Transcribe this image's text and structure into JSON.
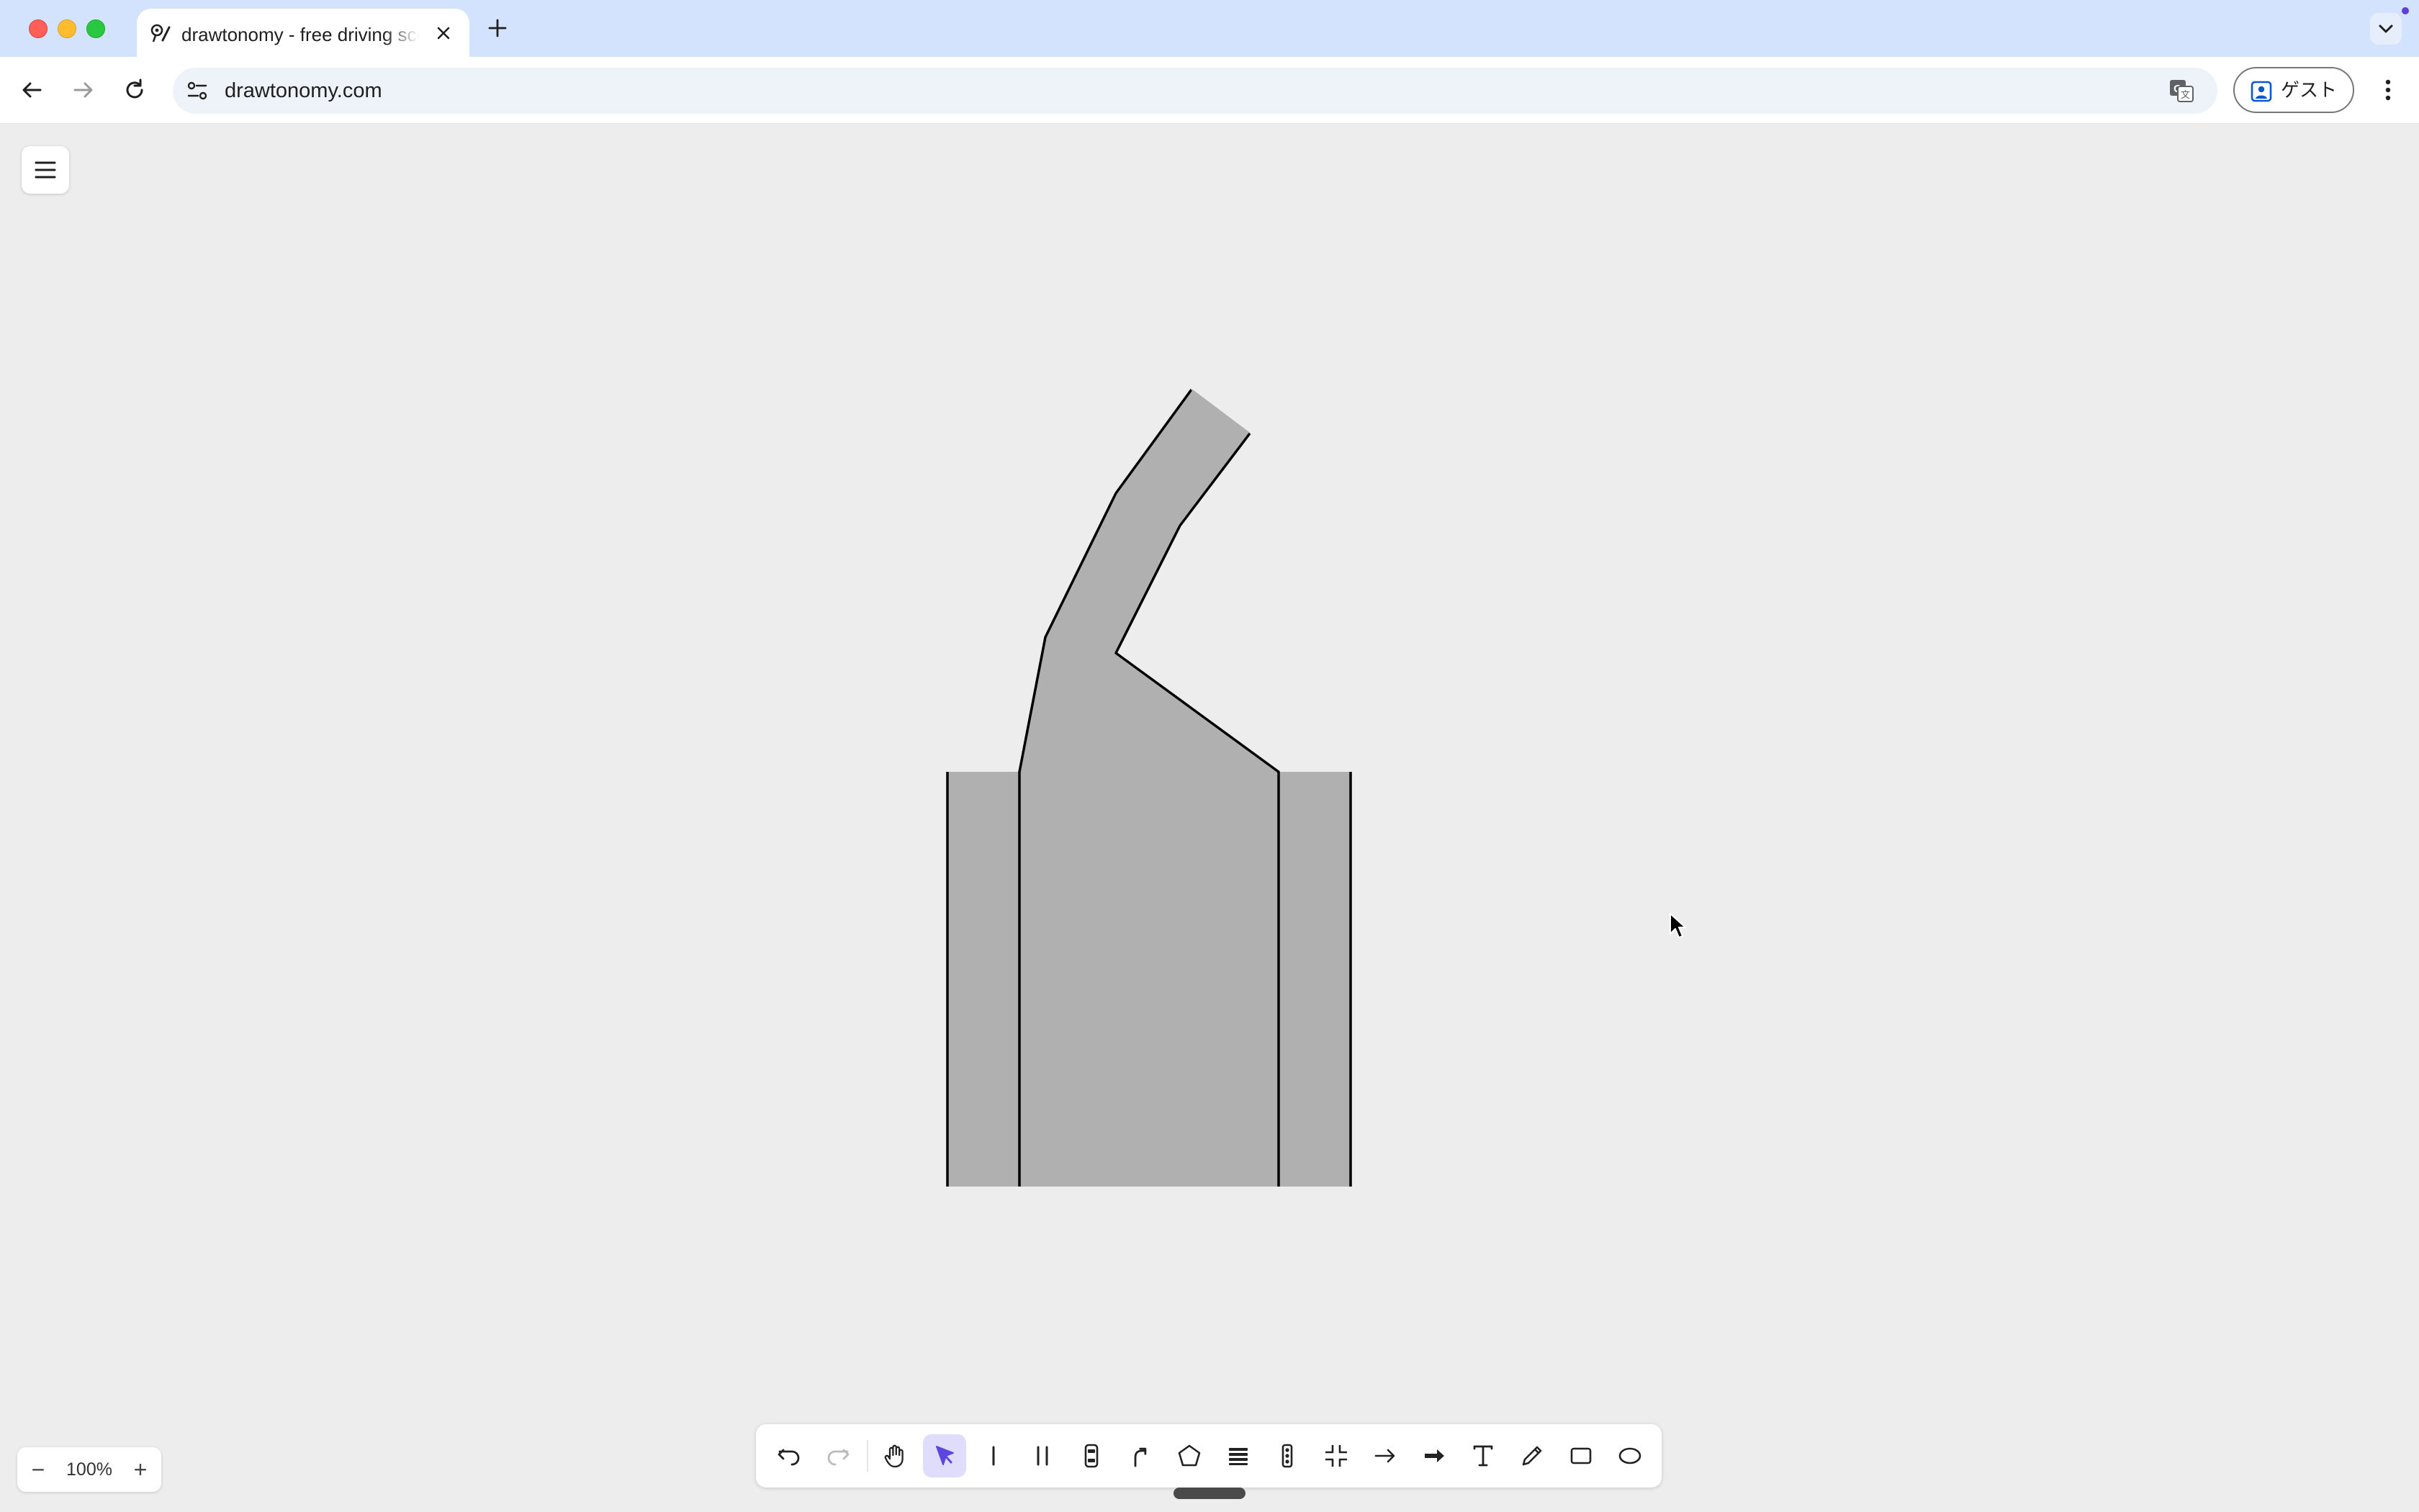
{
  "browser": {
    "tab": {
      "title": "drawtonomy - free driving scenario editor",
      "favicon": "drawtonomy-logo-icon"
    },
    "url": "drawtonomy.com",
    "profile_label": "ゲスト",
    "icons": [
      "back-icon",
      "forward-icon",
      "reload-icon",
      "site-info-icon",
      "translate-icon",
      "person-icon",
      "more-vert-icon",
      "close-icon",
      "plus-icon",
      "chevron-down-icon"
    ]
  },
  "app": {
    "menu_icon": "hamburger-icon",
    "zoom": {
      "minus": "−",
      "value": "100%",
      "plus": "+"
    },
    "canvas": {
      "road_fill": "#b0b0b0",
      "stroke": "#000000",
      "background": "#ededed"
    },
    "toolbar": {
      "active_tool": "select",
      "accent": "#5b46e0",
      "tools": [
        {
          "id": "undo",
          "icon": "undo-icon"
        },
        {
          "id": "redo",
          "icon": "redo-icon"
        },
        {
          "id": "pan",
          "icon": "hand-icon"
        },
        {
          "id": "select",
          "icon": "pointer-icon"
        },
        {
          "id": "lane",
          "icon": "single-line-icon"
        },
        {
          "id": "road",
          "icon": "double-line-icon"
        },
        {
          "id": "vehicle",
          "icon": "car-icon"
        },
        {
          "id": "path",
          "icon": "path-arrow-icon"
        },
        {
          "id": "polygon",
          "icon": "pentagon-icon"
        },
        {
          "id": "crosswalk",
          "icon": "crosswalk-icon"
        },
        {
          "id": "traffic-light",
          "icon": "traffic-light-icon"
        },
        {
          "id": "intersection",
          "icon": "intersection-icon"
        },
        {
          "id": "arrow",
          "icon": "arrow-right-icon"
        },
        {
          "id": "thick-arrow",
          "icon": "thick-arrow-icon"
        },
        {
          "id": "text",
          "icon": "text-icon"
        },
        {
          "id": "pen",
          "icon": "pencil-icon"
        },
        {
          "id": "rectangle",
          "icon": "rectangle-icon"
        },
        {
          "id": "ellipse",
          "icon": "ellipse-icon"
        }
      ]
    }
  }
}
